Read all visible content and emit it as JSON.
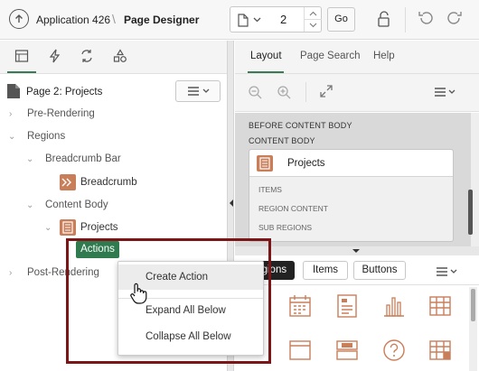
{
  "header": {
    "app_name": "Application 426",
    "page_designer": "Page Designer",
    "page_number": "2",
    "go_label": "Go"
  },
  "tree": {
    "page_title": "Page 2: Projects",
    "nodes": {
      "pre_rendering": "Pre-Rendering",
      "regions": "Regions",
      "breadcrumb_bar": "Breadcrumb Bar",
      "breadcrumb": "Breadcrumb",
      "content_body": "Content Body",
      "projects": "Projects",
      "actions": "Actions",
      "post_rendering": "Post-Rendering"
    }
  },
  "context_menu": {
    "create_action": "Create Action",
    "expand_all_below": "Expand All Below",
    "collapse_all_below": "Collapse All Below"
  },
  "right_panel": {
    "tabs": [
      "Layout",
      "Page Search",
      "Help"
    ],
    "active_tab": "Layout",
    "canvas": {
      "before_content_body": "BEFORE CONTENT BODY",
      "content_body": "CONTENT BODY",
      "region_title": "Projects",
      "items": "ITEMS",
      "region_content": "REGION CONTENT",
      "sub_regions": "SUB REGIONS"
    },
    "gallery_tabs": [
      "Regions",
      "Items",
      "Buttons"
    ],
    "gallery_active": "Regions"
  },
  "colors": {
    "accent_green": "#2f7b4f",
    "region_icon": "#c97e5a",
    "callout_border": "#7c1518"
  }
}
